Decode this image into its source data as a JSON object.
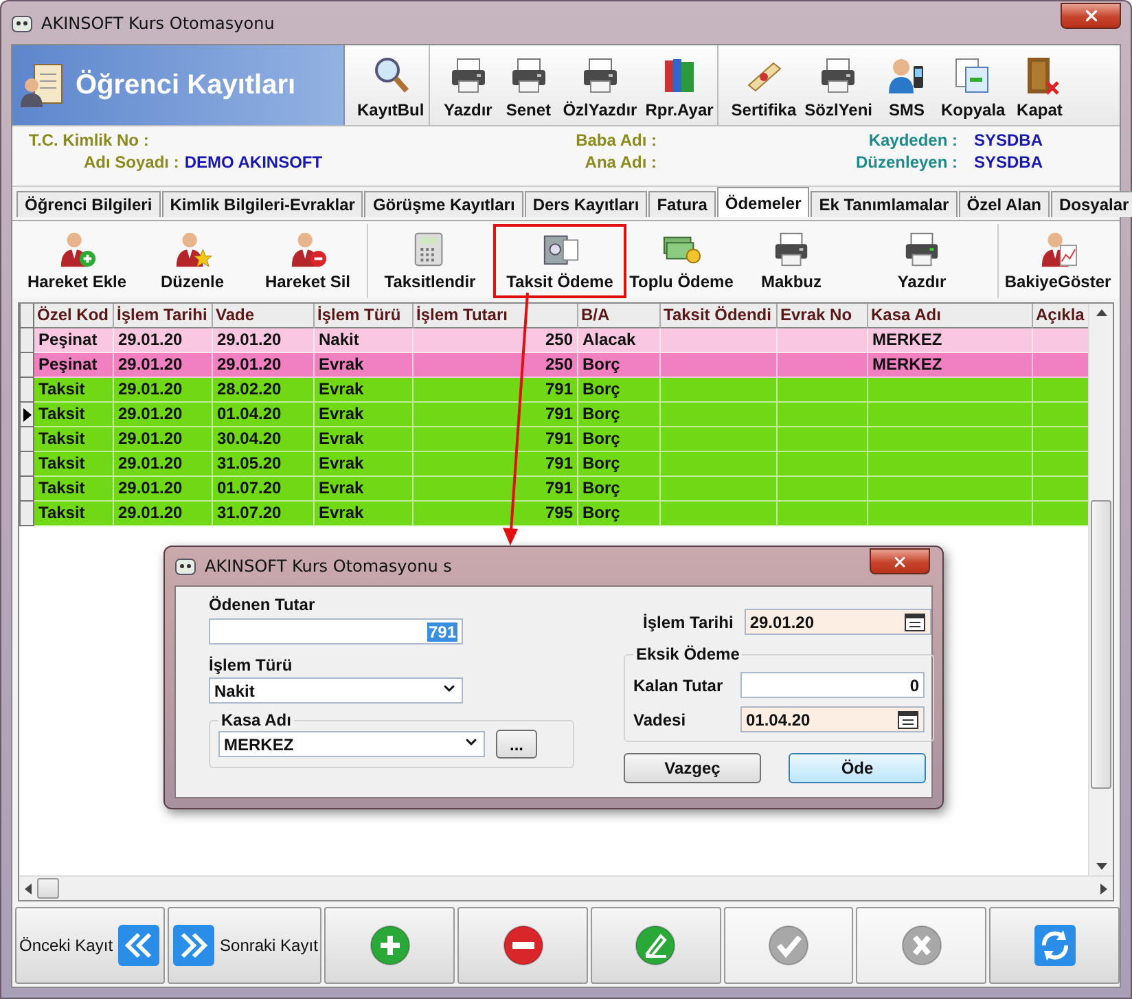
{
  "window": {
    "title": "AKINSOFT Kurs Otomasyonu"
  },
  "header": {
    "title": "Öğrenci Kayıtları",
    "toolbar": [
      {
        "label": "KayıtBul"
      },
      {
        "label": "Yazdır"
      },
      {
        "label": "Senet"
      },
      {
        "label": "ÖzlYazdır"
      },
      {
        "label": "Rpr.Ayar"
      },
      {
        "label": "Sertifika"
      },
      {
        "label": "SözlYeni"
      },
      {
        "label": "SMS"
      },
      {
        "label": "Kopyala"
      },
      {
        "label": "Kapat"
      }
    ]
  },
  "info": {
    "tc_label": "T.C. Kimlik No :",
    "name_label": "Adı Soyadı :",
    "name_value": "DEMO AKINSOFT",
    "father_label": "Baba Adı :",
    "mother_label": "Ana Adı :",
    "created_label": "Kaydeden :",
    "created_value": "SYSDBA",
    "edited_label": "Düzenleyen :",
    "edited_value": "SYSDBA"
  },
  "tabs": [
    {
      "label": "Öğrenci Bilgileri",
      "selected": false
    },
    {
      "label": "Kimlik Bilgileri-Evraklar",
      "selected": false
    },
    {
      "label": "Görüşme Kayıtları",
      "selected": false
    },
    {
      "label": "Ders Kayıtları",
      "selected": false
    },
    {
      "label": "Fatura",
      "selected": false
    },
    {
      "label": "Ödemeler",
      "selected": true
    },
    {
      "label": "Ek Tanımlamalar",
      "selected": false
    },
    {
      "label": "Özel Alan",
      "selected": false
    },
    {
      "label": "Dosyalar",
      "selected": false
    }
  ],
  "actions": [
    {
      "label": "Hareket Ekle",
      "highlighted": false
    },
    {
      "label": "Düzenle",
      "highlighted": false
    },
    {
      "label": "Hareket Sil",
      "highlighted": false
    },
    {
      "label": "Taksitlendir",
      "highlighted": false
    },
    {
      "label": "Taksit Ödeme",
      "highlighted": true
    },
    {
      "label": "Toplu Ödeme",
      "highlighted": false
    },
    {
      "label": "Makbuz",
      "highlighted": false
    },
    {
      "label": "Yazdır",
      "highlighted": false
    },
    {
      "label": "BakiyeGöster",
      "highlighted": false
    }
  ],
  "table": {
    "columns": [
      "Özel Kod",
      "İşlem Tarihi",
      "Vade",
      "İşlem Türü",
      "İşlem Tutarı",
      "B/A",
      "Taksit Ödendi",
      "Evrak No",
      "Kasa Adı",
      "Açıkla"
    ],
    "rows": [
      {
        "color": "#f9c8e0",
        "selected": false,
        "cells": [
          "Peşinat",
          "29.01.20",
          "29.01.20",
          "Nakit",
          "250",
          "Alacak",
          null,
          null,
          "MERKEZ",
          null
        ]
      },
      {
        "color": "#f080c0",
        "selected": false,
        "cells": [
          "Peşinat",
          "29.01.20",
          "29.01.20",
          "Evrak",
          "250",
          "Borç",
          null,
          null,
          "MERKEZ",
          null
        ]
      },
      {
        "color": "#70d814",
        "selected": false,
        "cells": [
          "Taksit",
          "29.01.20",
          "28.02.20",
          "Evrak",
          "791",
          "Borç",
          null,
          null,
          null,
          null
        ]
      },
      {
        "color": "#70d814",
        "selected": true,
        "cells": [
          "Taksit",
          "29.01.20",
          "01.04.20",
          "Evrak",
          "791",
          "Borç",
          null,
          null,
          null,
          null
        ]
      },
      {
        "color": "#70d814",
        "selected": false,
        "cells": [
          "Taksit",
          "29.01.20",
          "30.04.20",
          "Evrak",
          "791",
          "Borç",
          null,
          null,
          null,
          null
        ]
      },
      {
        "color": "#70d814",
        "selected": false,
        "cells": [
          "Taksit",
          "29.01.20",
          "31.05.20",
          "Evrak",
          "791",
          "Borç",
          null,
          null,
          null,
          null
        ]
      },
      {
        "color": "#70d814",
        "selected": false,
        "cells": [
          "Taksit",
          "29.01.20",
          "01.07.20",
          "Evrak",
          "791",
          "Borç",
          null,
          null,
          null,
          null
        ]
      },
      {
        "color": "#70d814",
        "selected": false,
        "cells": [
          "Taksit",
          "29.01.20",
          "31.07.20",
          "Evrak",
          "795",
          "Borç",
          null,
          null,
          null,
          null
        ]
      }
    ]
  },
  "dialog": {
    "title": "AKINSOFT Kurs Otomasyonu s",
    "paid": {
      "label": "Ödenen Tutar",
      "value": "791"
    },
    "type": {
      "label": "İşlem Türü",
      "value": "Nakit"
    },
    "cash": {
      "label": "Kasa Adı",
      "value": "MERKEZ",
      "button": "..."
    },
    "date": {
      "label": "İşlem Tarihi",
      "value": "29.01.20"
    },
    "partial": {
      "title": "Eksik Ödeme",
      "remaining_label": "Kalan Tutar",
      "remaining_value": "0",
      "due_label": "Vadesi",
      "due_value": "01.04.20"
    },
    "buttons": [
      {
        "label": "Vazgeç",
        "focused": false
      },
      {
        "label": "Öde",
        "focused": true
      }
    ]
  },
  "nav": [
    {
      "label": "Önceki Kayıt",
      "disabled": false
    },
    {
      "label": "Sonraki Kayıt",
      "disabled": false
    },
    {
      "disabled": false
    },
    {
      "disabled": false
    },
    {
      "disabled": false
    },
    {
      "disabled": true
    },
    {
      "disabled": true
    },
    {
      "disabled": false
    }
  ]
}
